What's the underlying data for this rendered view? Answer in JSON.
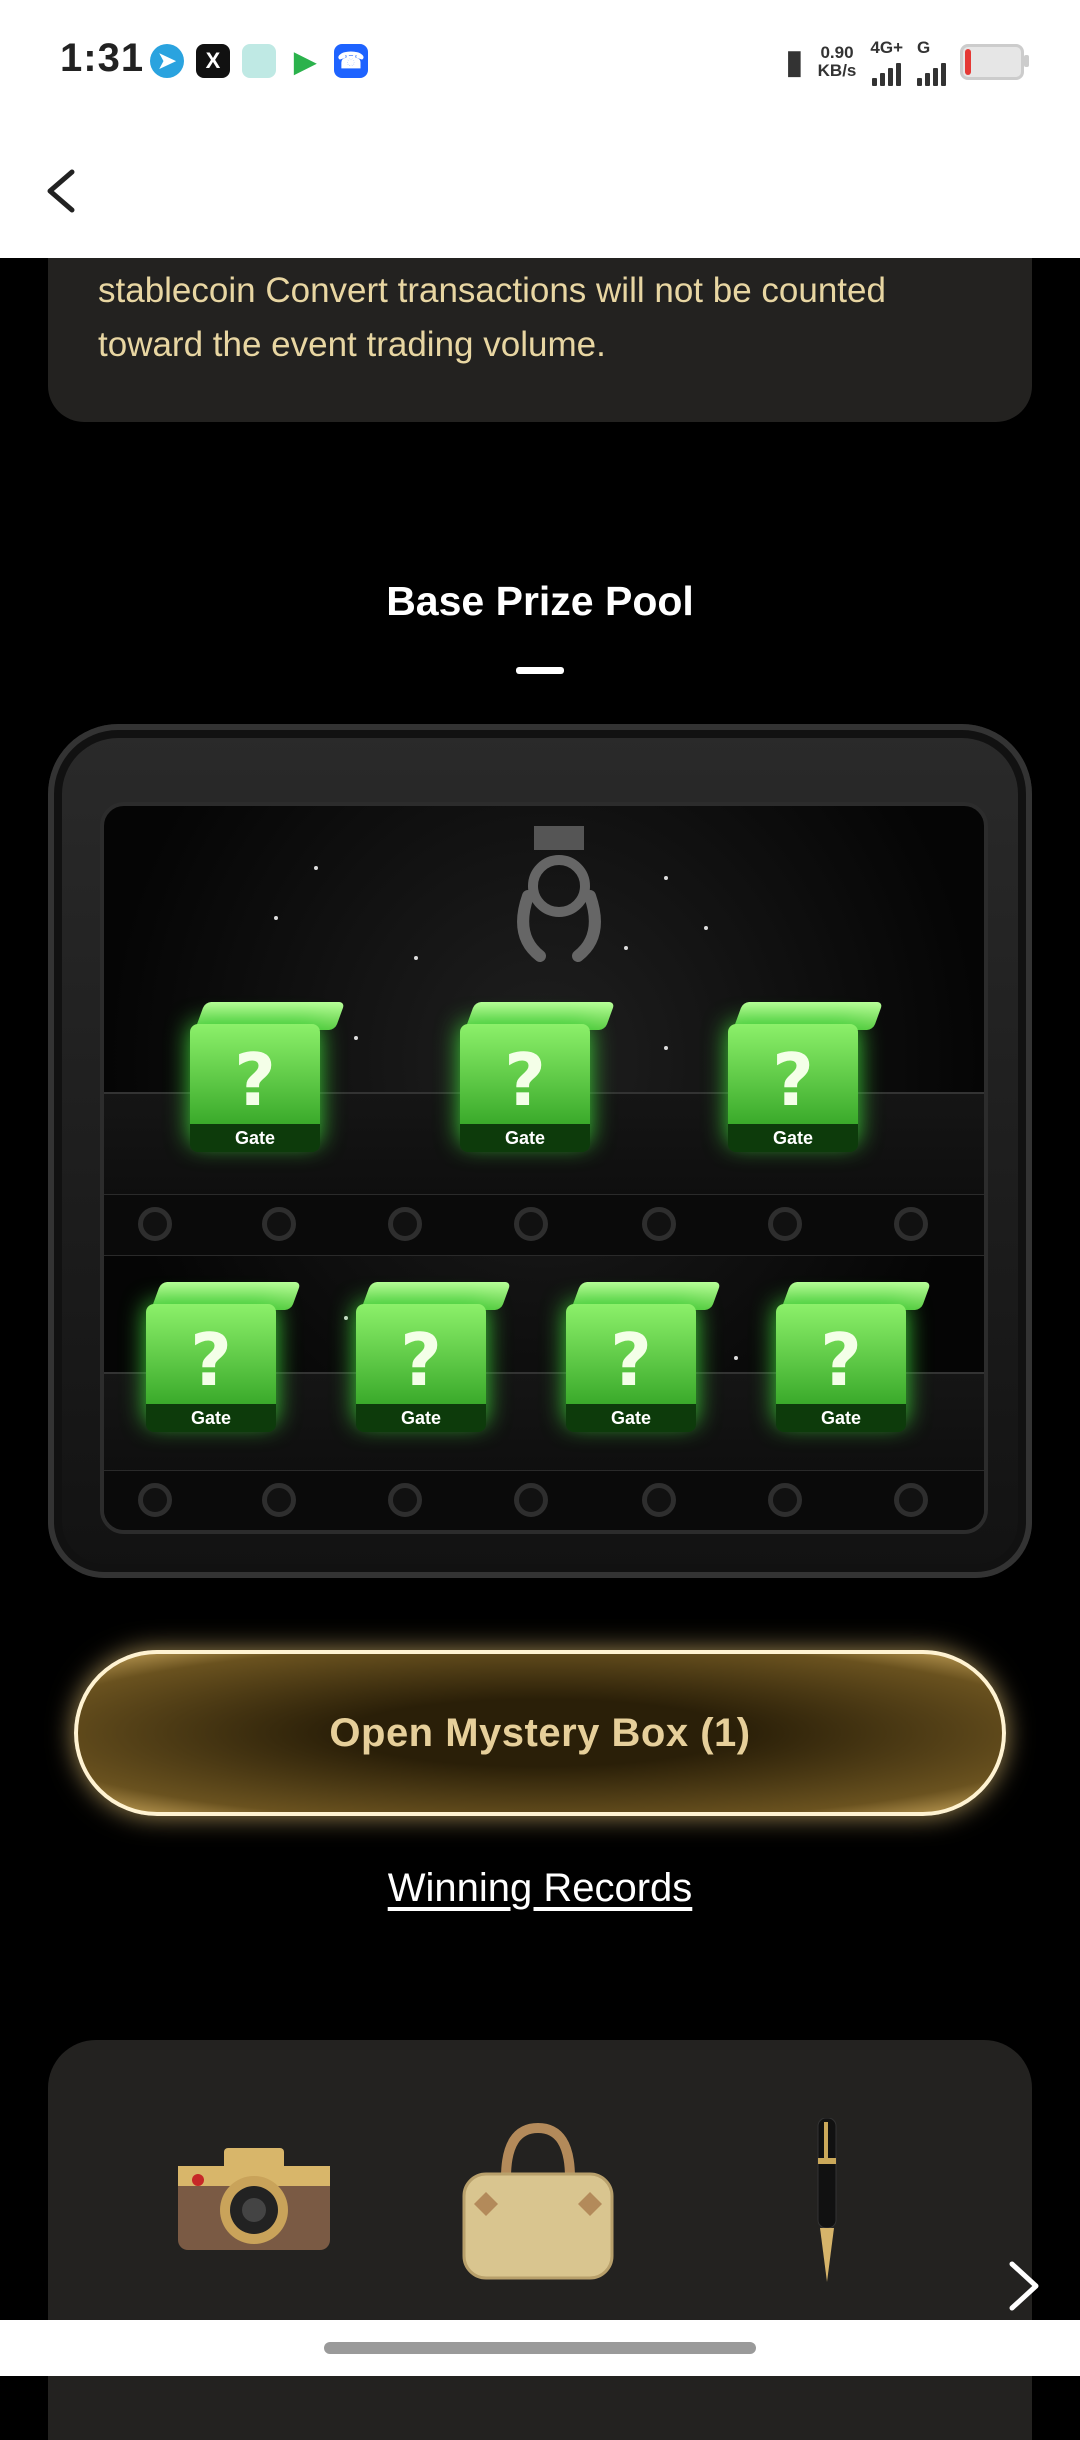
{
  "status_bar": {
    "time": "1:31",
    "net_speed_value": "0.90",
    "net_speed_unit": "KB/s",
    "network_primary": "4G+",
    "network_secondary": "G"
  },
  "nav": {
    "back_icon": "chevron-left-icon"
  },
  "info_card": {
    "text": "stablecoin Convert transactions will not be counted toward the event trading volume."
  },
  "prize_pool": {
    "title": "Base Prize Pool",
    "box_brand": "Gate",
    "box_symbol": "?"
  },
  "actions": {
    "open_box": "Open Mystery Box (1)",
    "winning_records": "Winning Records"
  },
  "prizes": {
    "items": [
      "camera-icon",
      "handbag-icon",
      "fountain-pen-icon"
    ],
    "next_icon": "chevron-right-icon"
  },
  "colors": {
    "accent_gold": "#e6cf9a",
    "card_bg": "#232220",
    "box_green": "#5ccc45"
  }
}
